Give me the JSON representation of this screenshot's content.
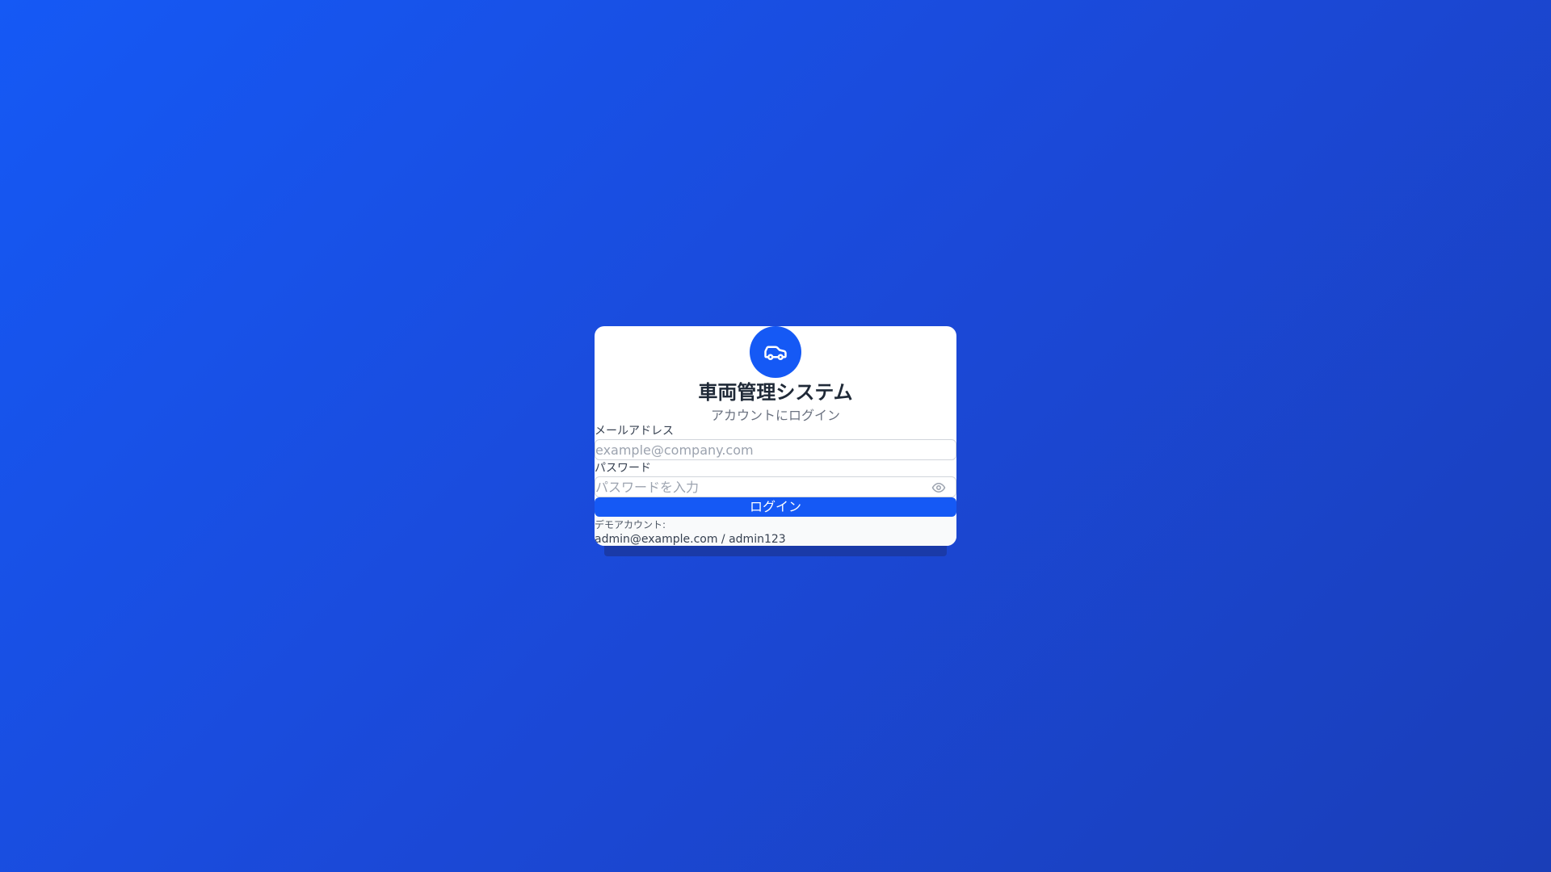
{
  "app": {
    "title": "車両管理システム",
    "subtitle": "アカウントにログイン",
    "logo_icon": "car-icon"
  },
  "form": {
    "email": {
      "label": "メールアドレス",
      "placeholder": "example@company.com",
      "value": ""
    },
    "password": {
      "label": "パスワード",
      "placeholder": "パスワードを入力",
      "value": "",
      "toggle_icon": "eye-icon"
    },
    "submit_label": "ログイン"
  },
  "demo": {
    "label": "デモアカウント:",
    "credentials": "admin@example.com / admin123"
  },
  "colors": {
    "primary": "#1559f5",
    "background_start": "#1559f5",
    "background_end": "#1a3eb8",
    "card": "#ffffff"
  }
}
